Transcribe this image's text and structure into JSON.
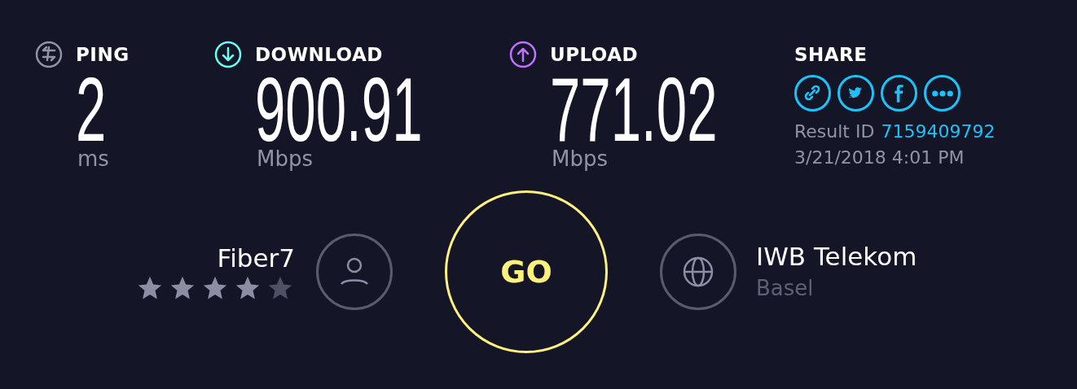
{
  "metrics": [
    {
      "kind": "ping",
      "label": "PING",
      "value": "2",
      "unit": "ms",
      "color": "#9193a8"
    },
    {
      "kind": "download",
      "label": "DOWNLOAD",
      "value": "900.91",
      "unit": "Mbps",
      "color": "#6afff3"
    },
    {
      "kind": "upload",
      "label": "UPLOAD",
      "value": "771.02",
      "unit": "Mbps",
      "color": "#bf71ff"
    }
  ],
  "share": {
    "title": "SHARE",
    "buttons": [
      {
        "kind": "link"
      },
      {
        "kind": "twitter"
      },
      {
        "kind": "facebook"
      },
      {
        "kind": "more"
      }
    ],
    "result_label": "Result ID",
    "result_id": "7159409792",
    "datetime": "3/21/2018 4:01 PM"
  },
  "isp": {
    "name": "Fiber7",
    "stars": 4
  },
  "go": {
    "label": "GO"
  },
  "server": {
    "name": "IWB Telekom",
    "location": "Basel"
  }
}
